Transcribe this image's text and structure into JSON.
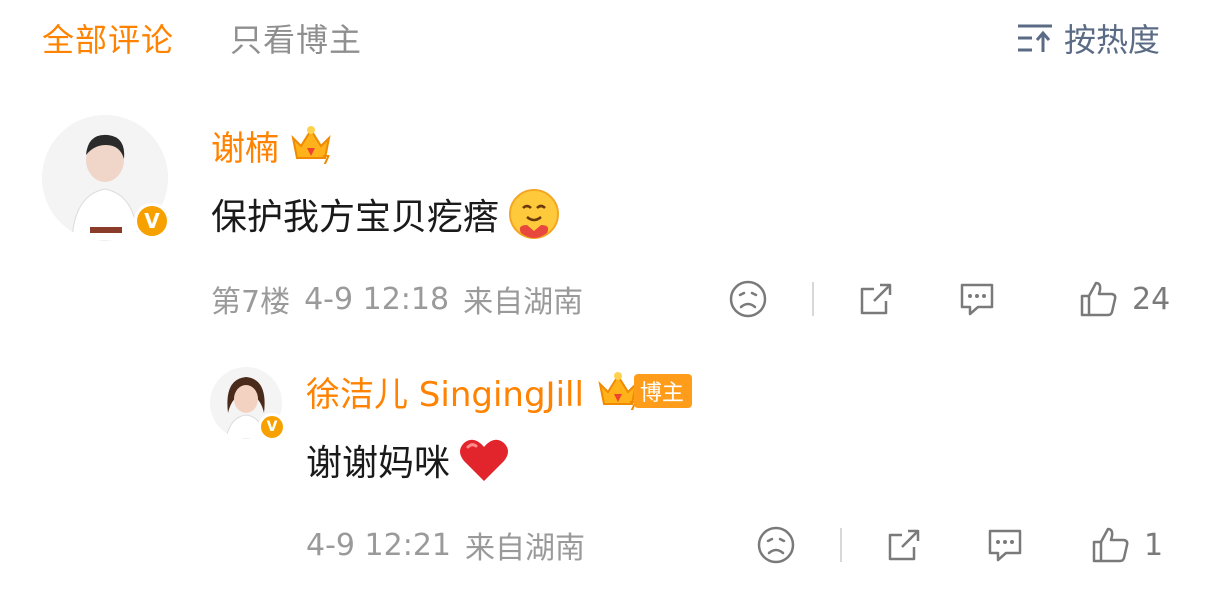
{
  "tabs": {
    "all_comments": "全部评论",
    "blogger_only": "只看博主"
  },
  "sort": {
    "label": "按热度",
    "icon": "sort-icon"
  },
  "comments": [
    {
      "user": "谢楠",
      "content": "保护我方宝贝疙瘩",
      "floor": "第7楼",
      "date": "4-9 12:18",
      "location": "来自湖南",
      "likes": "24"
    }
  ],
  "replies": [
    {
      "user": "徐洁儿 SingingJill",
      "tag": "博主",
      "content": "谢谢妈咪",
      "date": "4-9 12:21",
      "location": "来自湖南",
      "likes": "1"
    }
  ],
  "colors": {
    "accent": "#ff8200",
    "muted": "#8f8f8f",
    "sort": "#5b6b85",
    "heart": "#e2242c"
  }
}
